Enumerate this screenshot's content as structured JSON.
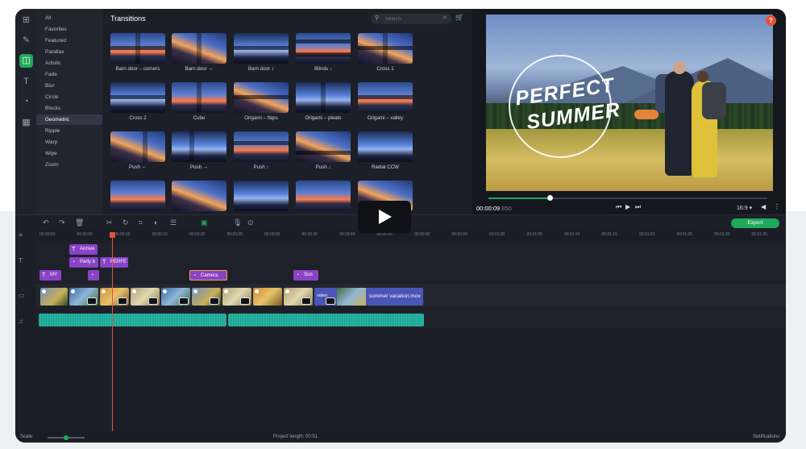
{
  "categories": [
    "All",
    "Favorites",
    "Featured",
    "Parallax",
    "Artistic",
    "Fade",
    "Blur",
    "Circle",
    "Blocks",
    "Geometric",
    "Ripple",
    "Warp",
    "Wipe",
    "Zoom"
  ],
  "selected_category": "Geometric",
  "transitions": {
    "title": "Transitions",
    "search_placeholder": "Search",
    "items": [
      "Barn door – corners",
      "Barn door ↔",
      "Barn door ↕",
      "Blinds ↓",
      "Cross 1",
      "Cross 2",
      "Cube",
      "Origami – flaps",
      "Origami – pleats",
      "Origami – valley",
      "Push ←",
      "Push →",
      "Push ↑",
      "Push ↓",
      "Radial CCW"
    ]
  },
  "preview": {
    "title_line1": "PERFECT",
    "title_line2": "SUMMER",
    "time": "00:00:09",
    "time_ms": ".850",
    "progress": 0.22,
    "aspect": "16:9 ▾",
    "help": "?"
  },
  "toolbar": {
    "export_label": "Export"
  },
  "ruler": [
    "00:00:00",
    "00:00:05",
    "00:00:10",
    "00:00:15",
    "00:00:20",
    "00:00:25",
    "00:00:30",
    "00:00:35",
    "00:00:40",
    "00:00:45",
    "00:00:50",
    "00:00:55",
    "00:01:00",
    "00:01:05",
    "00:01:10",
    "00:01:15",
    "00:01:20",
    "00:01:25",
    "00:01:30",
    "00:01:35"
  ],
  "timeline": {
    "title_clips": [
      "Annive",
      "Party b",
      "PERFE",
      "MY",
      "Camera",
      "Sun"
    ],
    "video_clip_name": "summer vacation.mov",
    "video_small_label": "video"
  },
  "status": {
    "scale": "Scale:",
    "project_length": "Project length: 00:51",
    "notifications": "Notifications"
  },
  "colors": {
    "accent": "#1faa5a",
    "title_clip": "#8a43c7",
    "audio": "#26b3a0",
    "playhead": "#e5533c"
  }
}
